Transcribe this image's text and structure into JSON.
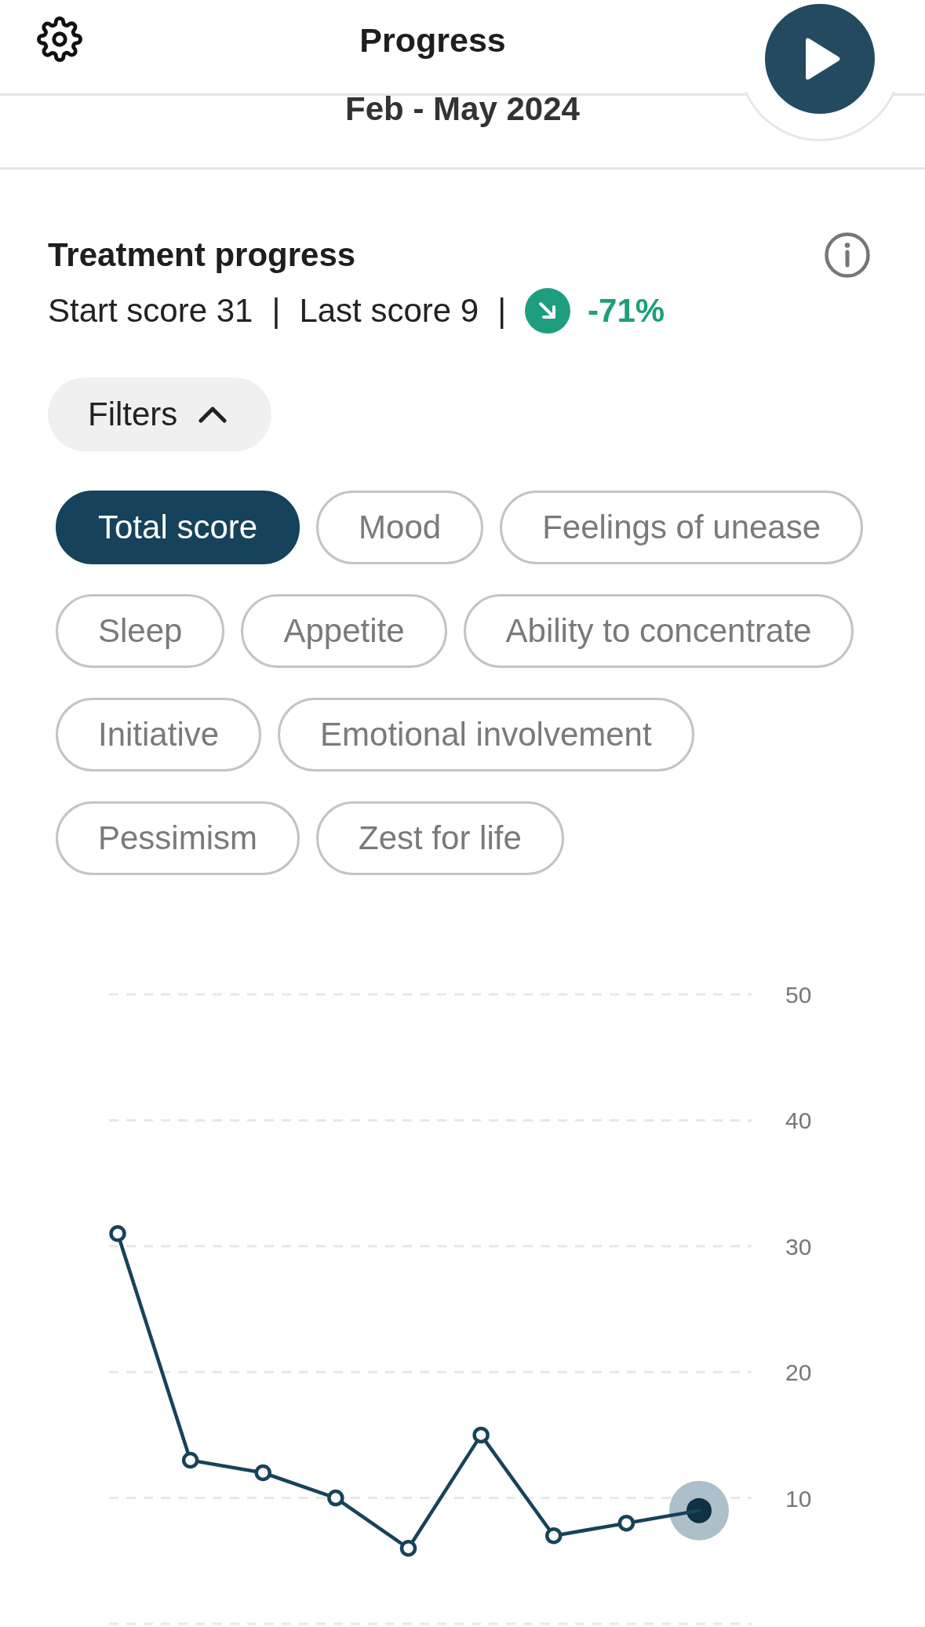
{
  "header": {
    "title": "Progress"
  },
  "period": {
    "label": "Feb - May 2024"
  },
  "summary": {
    "title": "Treatment progress",
    "start_score": "Start score 31",
    "separators": [
      "|",
      "|"
    ],
    "last_score": "Last score 9",
    "change": "-71%"
  },
  "filters": {
    "label": "Filters",
    "expanded": true,
    "options": [
      {
        "label": "Total score",
        "selected": true
      },
      {
        "label": "Mood",
        "selected": false
      },
      {
        "label": "Feelings of unease",
        "selected": false
      },
      {
        "label": "Sleep",
        "selected": false
      },
      {
        "label": "Appetite",
        "selected": false
      },
      {
        "label": "Ability to concentrate",
        "selected": false
      },
      {
        "label": "Initiative",
        "selected": false
      },
      {
        "label": "Emotional involvement",
        "selected": false
      },
      {
        "label": "Pessimism",
        "selected": false
      },
      {
        "label": "Zest for life",
        "selected": false
      }
    ]
  },
  "chart": {
    "chart_data": {
      "type": "line",
      "categories": [
        null,
        null,
        null,
        null,
        null,
        null,
        null,
        null,
        null
      ],
      "values": [
        31,
        13,
        12,
        10,
        6,
        15,
        7,
        8,
        9
      ],
      "ylim": [
        0,
        50
      ],
      "yticks": [
        10,
        20,
        30,
        40,
        50
      ],
      "grid": true,
      "marker": "circle"
    }
  }
}
